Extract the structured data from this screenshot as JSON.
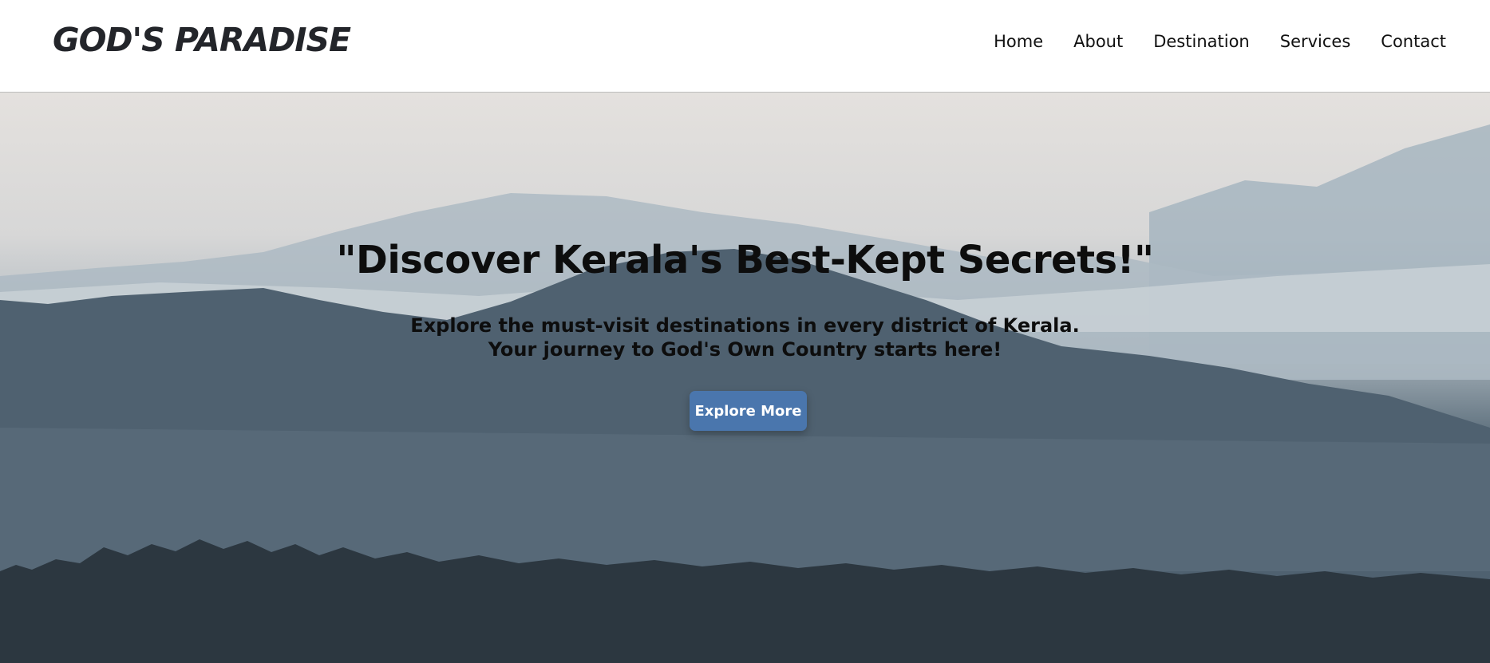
{
  "header": {
    "logo": "GOD'S PARADISE",
    "nav": [
      {
        "label": "Home"
      },
      {
        "label": "About"
      },
      {
        "label": "Destination"
      },
      {
        "label": "Services"
      },
      {
        "label": "Contact"
      }
    ]
  },
  "hero": {
    "title": "\"Discover Kerala's Best-Kept Secrets!\"",
    "subtitle_line1": "Explore the must-visit destinations in every district of Kerala.",
    "subtitle_line2": "Your journey to God's Own Country starts here!",
    "cta_label": "Explore More",
    "background_image": "misty-mountains-photo"
  },
  "colors": {
    "accent": "#4a76ad",
    "nav_text": "#111111",
    "logo_text": "#23252a"
  }
}
